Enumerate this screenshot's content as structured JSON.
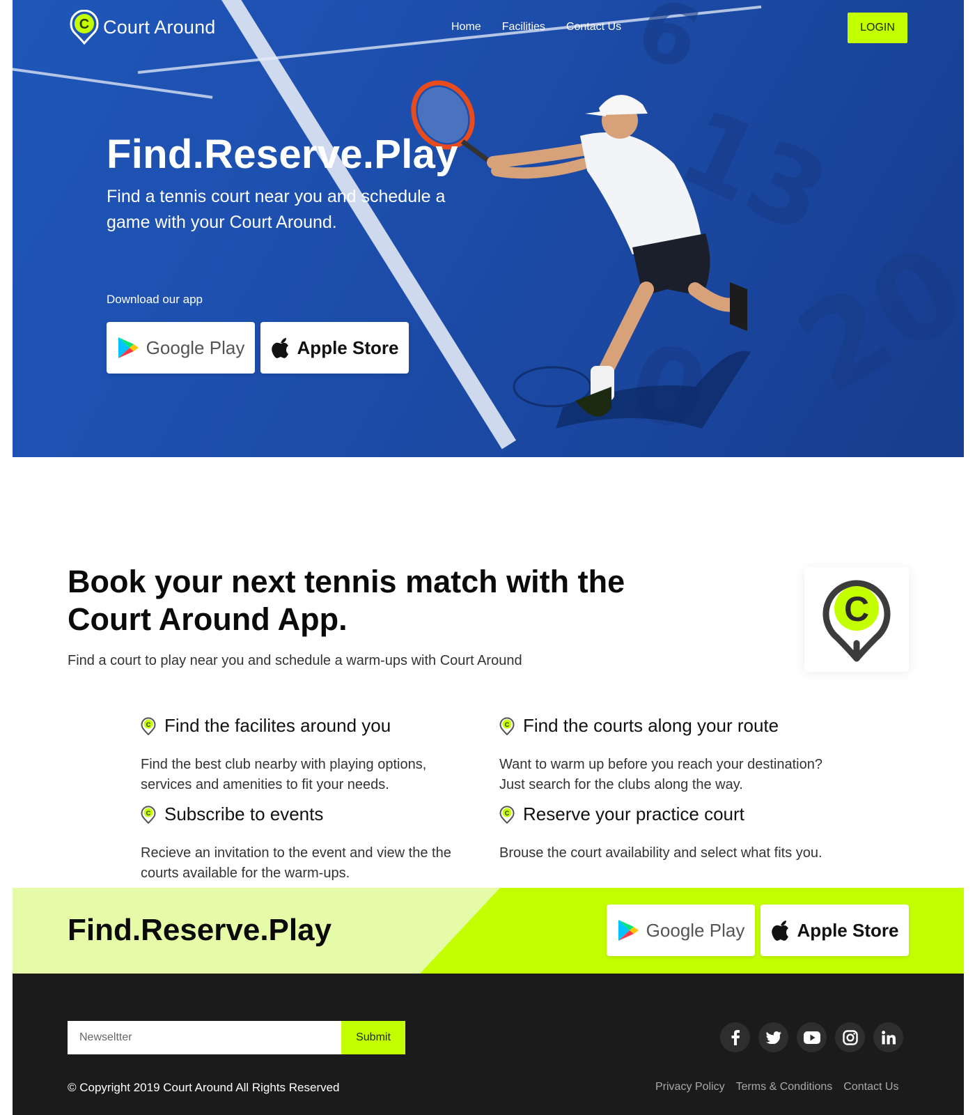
{
  "header": {
    "brand": "Court Around",
    "nav": [
      "Home",
      "Facilities",
      "Contact Us"
    ],
    "login_label": "LOGIN"
  },
  "hero": {
    "title": "Find.Reserve.Play",
    "subtitle": "Find a tennis court near you and schedule a game with your Court Around.",
    "download_label": "Download our app",
    "google_play_label": "Google Play",
    "apple_store_label": "Apple Store",
    "court_numbers": [
      "6",
      "13",
      "20",
      "0"
    ]
  },
  "intro": {
    "title": "Book your next tennis match with the Court Around App.",
    "subtitle": "Find a court to play near you and schedule a warm-ups with Court Around",
    "features": [
      {
        "title": "Find the facilites around you",
        "text": "Find the best club nearby with playing options, services and amenities to fit your needs."
      },
      {
        "title": "Find the courts along your route",
        "text": "Want to warm up before you reach your destination? Just search for the clubs along the way."
      },
      {
        "title": "Subscribe to events",
        "text": "Recieve an invitation to the event and view the the courts available for the warm-ups."
      },
      {
        "title": "Reserve your practice court",
        "text": "Brouse the court availability and select what fits you."
      }
    ]
  },
  "band": {
    "title": "Find.Reserve.Play",
    "google_play_label": "Google Play",
    "apple_store_label": "Apple Store"
  },
  "footer": {
    "newsletter_placeholder": "Newseltter",
    "submit_label": "Submit",
    "socials": [
      "facebook-icon",
      "twitter-icon",
      "youtube-icon",
      "instagram-icon",
      "linkedin-icon"
    ],
    "copyright": "© Copyright 2019 Court Around All Rights Reserved",
    "links": [
      "Privacy Policy",
      "Terms & Conditions",
      "Contact Us"
    ]
  },
  "colors": {
    "accent": "#c4ff00",
    "hero_blue": "#1d4fae",
    "footer_bg": "#1b1b1b",
    "band_light": "#e6fba8"
  }
}
